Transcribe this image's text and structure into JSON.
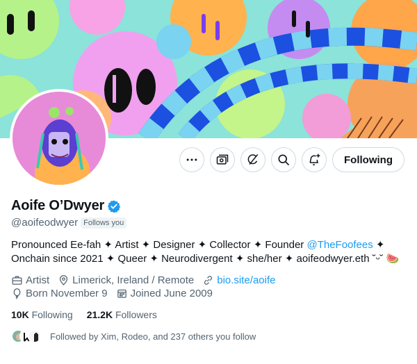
{
  "profile": {
    "display_name": "Aoife O’Dwyer",
    "handle": "@aoifeodwyer",
    "follows_you": "Follows you",
    "bio_line1_a": "Pronounced Ee-fah ✦ Artist ✦ Designer ✦ Collector ✦ Founder ",
    "bio_mention": "@TheFoofees",
    "bio_line1_b": " ✦",
    "bio_line2": "Onchain since 2021 ✦ Queer ✦ Neurodivergent ✦ she/her ✦ aoifeodwyer.eth ˘ᵕ˘ 🍉",
    "profession": "Artist",
    "location": "Limerick, Ireland / Remote",
    "website": "bio.site/aoife",
    "birthday": "Born November 9",
    "joined": "Joined June 2009"
  },
  "stats": {
    "following_count": "10K",
    "following_label": "Following",
    "followers_count": "21.2K",
    "followers_label": "Followers"
  },
  "followed_by": "Followed by Xim, Rodeo, and 237 others you follow",
  "actions": {
    "following_label": "Following",
    "more_icon": "more-icon",
    "subscriptions_icon": "subscriptions-icon",
    "grok_icon": "grok-icon",
    "search_icon": "search-icon",
    "notify_icon": "notify-icon"
  },
  "colors": {
    "link": "#1d9bf0",
    "secondary_text": "#536471",
    "verified": "#1d9bf0"
  }
}
